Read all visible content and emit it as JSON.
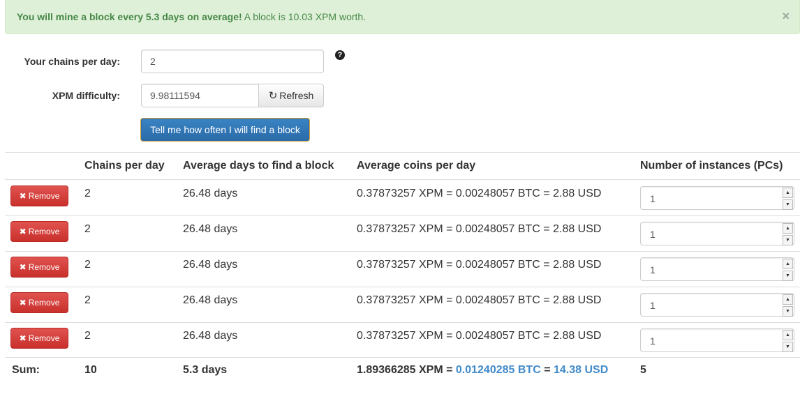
{
  "alert": {
    "strong": "You will mine a block every 5.3 days on average!",
    "rest": "A block is 10.03 XPM worth.",
    "close": "×"
  },
  "form": {
    "chains_label": "Your chains per day:",
    "chains_value": "2",
    "help_icon": "?",
    "difficulty_label": "XPM difficulty:",
    "difficulty_value": "9.98111594",
    "refresh_label": "Refresh",
    "submit_label": "Tell me how often I will find a block"
  },
  "table": {
    "headers": [
      "Chains per day",
      "Average days to find a block",
      "Average coins per day",
      "Number of instances (PCs)"
    ],
    "remove_label": "Remove",
    "rows": [
      {
        "chains": "2",
        "days": "26.48 days",
        "coins": "0.37873257 XPM = 0.00248057 BTC = 2.88 USD",
        "instances": "1"
      },
      {
        "chains": "2",
        "days": "26.48 days",
        "coins": "0.37873257 XPM = 0.00248057 BTC = 2.88 USD",
        "instances": "1"
      },
      {
        "chains": "2",
        "days": "26.48 days",
        "coins": "0.37873257 XPM = 0.00248057 BTC = 2.88 USD",
        "instances": "1"
      },
      {
        "chains": "2",
        "days": "26.48 days",
        "coins": "0.37873257 XPM = 0.00248057 BTC = 2.88 USD",
        "instances": "1"
      },
      {
        "chains": "2",
        "days": "26.48 days",
        "coins": "0.37873257 XPM = 0.00248057 BTC = 2.88 USD",
        "instances": "1"
      }
    ],
    "sum": {
      "label": "Sum:",
      "chains": "10",
      "days": "5.3 days",
      "xpm": "1.89366285 XPM =",
      "btc": "0.01240285 BTC",
      "eq": "=",
      "usd": "14.38 USD",
      "instances": "5"
    }
  },
  "colors": {
    "alert_bg": "#dff0d8",
    "alert_text": "#468847",
    "primary": "#2a6aa8",
    "danger": "#c9302c",
    "link_blue": "#428bca"
  }
}
